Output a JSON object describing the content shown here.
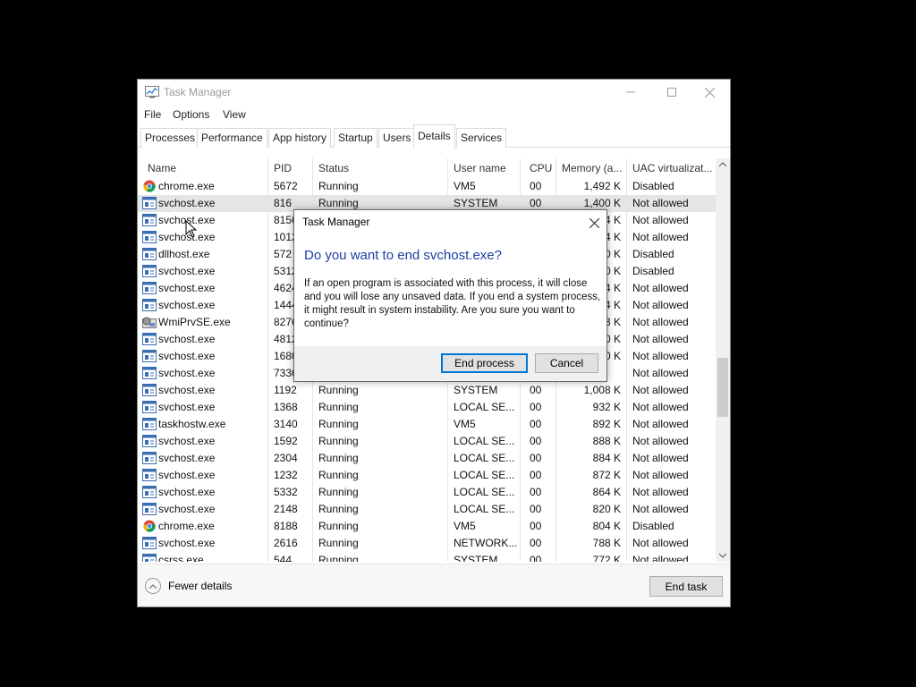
{
  "window": {
    "title": "Task Manager",
    "menu": [
      "File",
      "Options",
      "View"
    ],
    "tabs": [
      "Processes",
      "Performance",
      "App history",
      "Startup",
      "Users",
      "Details",
      "Services"
    ],
    "active_tab": "Details"
  },
  "table": {
    "columns": [
      "Name",
      "PID",
      "Status",
      "User name",
      "CPU",
      "Memory (a...",
      "UAC virtualizat..."
    ],
    "rows": [
      {
        "icon": "chrome-icon",
        "name": "chrome.exe",
        "pid": "5672",
        "status": "Running",
        "user": "VM5",
        "cpu": "00",
        "mem": "1,492 K",
        "uac": "Disabled"
      },
      {
        "icon": "service-host-icon",
        "name": "svchost.exe",
        "pid": "816",
        "status": "Running",
        "user": "SYSTEM",
        "cpu": "00",
        "mem": "1,400 K",
        "uac": "Not allowed"
      },
      {
        "icon": "service-host-icon",
        "name": "svchost.exe",
        "pid": "8156",
        "status": "",
        "user": "",
        "cpu": "",
        "mem": "4 K",
        "uac": "Not allowed"
      },
      {
        "icon": "service-host-icon",
        "name": "svchost.exe",
        "pid": "1012",
        "status": "",
        "user": "",
        "cpu": "",
        "mem": "4 K",
        "uac": "Not allowed"
      },
      {
        "icon": "service-host-icon",
        "name": "dllhost.exe",
        "pid": "572",
        "status": "",
        "user": "",
        "cpu": "",
        "mem": "0 K",
        "uac": "Disabled"
      },
      {
        "icon": "service-host-icon",
        "name": "svchost.exe",
        "pid": "5312",
        "status": "",
        "user": "",
        "cpu": "",
        "mem": "0 K",
        "uac": "Disabled"
      },
      {
        "icon": "service-host-icon",
        "name": "svchost.exe",
        "pid": "4624",
        "status": "",
        "user": "",
        "cpu": "",
        "mem": "4 K",
        "uac": "Not allowed"
      },
      {
        "icon": "service-host-icon",
        "name": "svchost.exe",
        "pid": "1444",
        "status": "",
        "user": "",
        "cpu": "",
        "mem": "4 K",
        "uac": "Not allowed"
      },
      {
        "icon": "wmi-icon",
        "name": "WmiPrvSE.exe",
        "pid": "8276",
        "status": "",
        "user": "",
        "cpu": "",
        "mem": "3 K",
        "uac": "Not allowed"
      },
      {
        "icon": "service-host-icon",
        "name": "svchost.exe",
        "pid": "4812",
        "status": "",
        "user": "",
        "cpu": "",
        "mem": "0 K",
        "uac": "Not allowed"
      },
      {
        "icon": "service-host-icon",
        "name": "svchost.exe",
        "pid": "1680",
        "status": "",
        "user": "",
        "cpu": "",
        "mem": "0 K",
        "uac": "Not allowed"
      },
      {
        "icon": "service-host-icon",
        "name": "svchost.exe",
        "pid": "7336",
        "status": "",
        "user": "",
        "cpu": "",
        "mem": "",
        "uac": "Not allowed"
      },
      {
        "icon": "service-host-icon",
        "name": "svchost.exe",
        "pid": "1192",
        "status": "Running",
        "user": "SYSTEM",
        "cpu": "00",
        "mem": "1,008 K",
        "uac": "Not allowed"
      },
      {
        "icon": "service-host-icon",
        "name": "svchost.exe",
        "pid": "1368",
        "status": "Running",
        "user": "LOCAL SE...",
        "cpu": "00",
        "mem": "932 K",
        "uac": "Not allowed"
      },
      {
        "icon": "service-host-icon",
        "name": "taskhostw.exe",
        "pid": "3140",
        "status": "Running",
        "user": "VM5",
        "cpu": "00",
        "mem": "892 K",
        "uac": "Not allowed"
      },
      {
        "icon": "service-host-icon",
        "name": "svchost.exe",
        "pid": "1592",
        "status": "Running",
        "user": "LOCAL SE...",
        "cpu": "00",
        "mem": "888 K",
        "uac": "Not allowed"
      },
      {
        "icon": "service-host-icon",
        "name": "svchost.exe",
        "pid": "2304",
        "status": "Running",
        "user": "LOCAL SE...",
        "cpu": "00",
        "mem": "884 K",
        "uac": "Not allowed"
      },
      {
        "icon": "service-host-icon",
        "name": "svchost.exe",
        "pid": "1232",
        "status": "Running",
        "user": "LOCAL SE...",
        "cpu": "00",
        "mem": "872 K",
        "uac": "Not allowed"
      },
      {
        "icon": "service-host-icon",
        "name": "svchost.exe",
        "pid": "5332",
        "status": "Running",
        "user": "LOCAL SE...",
        "cpu": "00",
        "mem": "864 K",
        "uac": "Not allowed"
      },
      {
        "icon": "service-host-icon",
        "name": "svchost.exe",
        "pid": "2148",
        "status": "Running",
        "user": "LOCAL SE...",
        "cpu": "00",
        "mem": "820 K",
        "uac": "Not allowed"
      },
      {
        "icon": "chrome-icon",
        "name": "chrome.exe",
        "pid": "8188",
        "status": "Running",
        "user": "VM5",
        "cpu": "00",
        "mem": "804 K",
        "uac": "Disabled"
      },
      {
        "icon": "service-host-icon",
        "name": "svchost.exe",
        "pid": "2616",
        "status": "Running",
        "user": "NETWORK...",
        "cpu": "00",
        "mem": "788 K",
        "uac": "Not allowed"
      },
      {
        "icon": "service-host-icon",
        "name": "csrss.exe",
        "pid": "544",
        "status": "Running",
        "user": "SYSTEM",
        "cpu": "00",
        "mem": "772 K",
        "uac": "Not allowed"
      }
    ]
  },
  "footer": {
    "fewer_details": "Fewer details",
    "end_task": "End task"
  },
  "dialog": {
    "title": "Task Manager",
    "heading": "Do you want to end svchost.exe?",
    "body": "If an open program is associated with this process, it will close and you will lose any unsaved data. If you end a system process, it might result in system instability. Are you sure you want to continue?",
    "confirm": "End process",
    "cancel": "Cancel"
  },
  "colors": {
    "heading_blue": "#1a3fa0",
    "focus_blue": "#0078d7",
    "selection": "#e5e5e5"
  }
}
